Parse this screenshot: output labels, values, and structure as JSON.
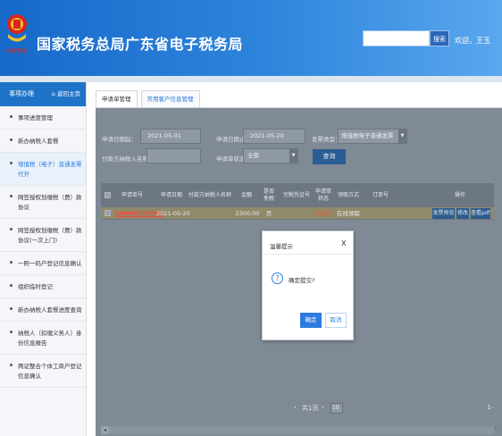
{
  "header": {
    "title": "国家税务总局广东省电子税务局",
    "brand": "中国税务",
    "search_placeholder": "",
    "search_label": "搜索",
    "welcome": "欢迎，王玉"
  },
  "sidebar": {
    "title": "事项办理",
    "home_label": "返回主页",
    "items": [
      {
        "label": "事项进度管理"
      },
      {
        "label": "新办纳税人套餐"
      },
      {
        "label": "增值税（电子）普通发票代开"
      },
      {
        "label": "网签授权划缴税（费）款协议"
      },
      {
        "label": "网签授权划缴税（费）款协议(一次上门)"
      },
      {
        "label": "一照一码户登记信息确认"
      },
      {
        "label": "组织临时登记"
      },
      {
        "label": "新办纳税人套餐进度查询"
      },
      {
        "label": "纳税人（扣缴义务人）身份信息报告"
      },
      {
        "label": "两证整合个体工商户登记信息确认"
      }
    ]
  },
  "tabs": [
    {
      "label": "申请单管理"
    },
    {
      "label": "常用客户信息管理"
    }
  ],
  "filters": {
    "start_label": "申请日期起：",
    "start_value": "2021-05-01",
    "end_label": "申请日期止：",
    "end_value": "2021-05-20",
    "invoice_type_label": "发票类型：",
    "invoice_type_value": "增值税电子普通发票",
    "payer_label": "付款方纳税人名称：",
    "payer_value": "",
    "status_label": "申请单状态：",
    "status_value": "全部",
    "query_label": "查询"
  },
  "table": {
    "headers": [
      "申请单号",
      "申请日期",
      "付款方纳税人名称",
      "金额",
      "是否免税",
      "完税凭证号",
      "申请单状态",
      "领取方式",
      "订单号",
      "操作"
    ],
    "rows": [
      {
        "id": "S00005197594",
        "date": "2021-05-20",
        "payer": "",
        "amount": "2300.00",
        "tax_free": "否",
        "voucher": "",
        "status": "未提交",
        "pickup": "在线领取",
        "order": "",
        "actions": [
          "发票预览",
          "修改",
          "查看pdf"
        ]
      }
    ]
  },
  "pager": {
    "total_text": "共1页",
    "page_size": "10",
    "right_text": "1-"
  },
  "dialog": {
    "title": "温馨提示",
    "close": "X",
    "message": "确定提交?",
    "ok_label": "确定",
    "cancel_label": "取消"
  }
}
